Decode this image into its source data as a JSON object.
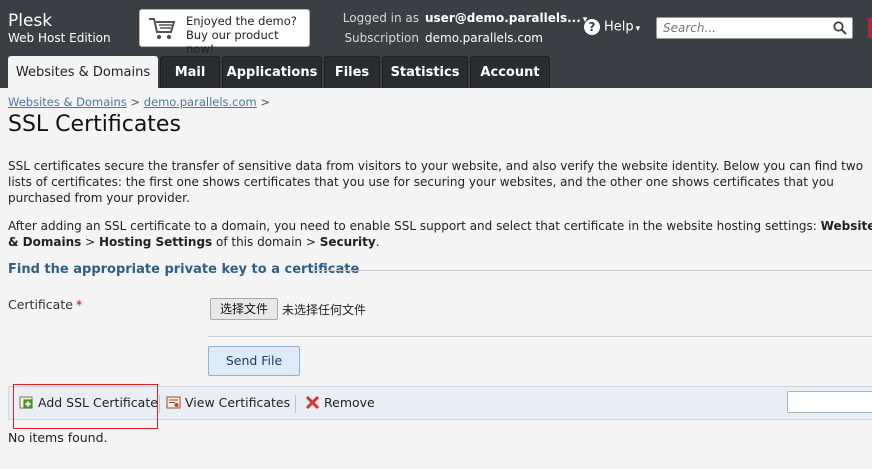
{
  "header": {
    "brand": "Plesk",
    "edition": "Web Host Edition",
    "promo": {
      "line1": "Enjoyed the demo?",
      "line2": "Buy our product now!"
    },
    "logged_in_label": "Logged in as",
    "user": "user@demo.parallels...",
    "subscription_label": "Subscription",
    "subscription": "demo.parallels.com",
    "help_label": "Help",
    "search_placeholder": "Search..."
  },
  "tabs": [
    {
      "label": "Websites & Domains",
      "active": true
    },
    {
      "label": "Mail"
    },
    {
      "label": "Applications"
    },
    {
      "label": "Files"
    },
    {
      "label": "Statistics"
    },
    {
      "label": "Account"
    }
  ],
  "breadcrumb": {
    "item1": "Websites & Domains",
    "sep": ">",
    "item2": "demo.parallels.com"
  },
  "page_title": "SSL Certificates",
  "para1": "SSL certificates secure the transfer of sensitive data from visitors to your website, and also verify the website identity. Below you can find two lists of certificates: the first one shows certificates that you use for securing your websites, and the other one shows certificates that you purchased from your provider.",
  "para2_text": "After adding an SSL certificate to a domain, you need to enable SSL support and select that certificate in the website hosting settings: ",
  "para2_bold1": "Websites & Domains",
  "para2_mid": " > ",
  "para2_bold2": "Hosting Settings",
  "para2_mid2": " of this domain > ",
  "para2_bold3": "Security",
  "para2_end": ".",
  "section_heading": "Find the appropriate private key to a certificate",
  "form": {
    "certificate_label": "Certificate",
    "required_mark": "*",
    "file_button": "选择文件",
    "file_status": "未选择任何文件",
    "send_button": "Send File"
  },
  "toolbar": {
    "add": "Add SSL Certificate",
    "view": "View Certificates",
    "remove": "Remove"
  },
  "empty_message": "No items found.",
  "colors": {
    "header_bg": "#3b3f43",
    "link": "#4a77a8",
    "section_heading": "#2e5f8a",
    "highlight": "#e21e1e"
  }
}
